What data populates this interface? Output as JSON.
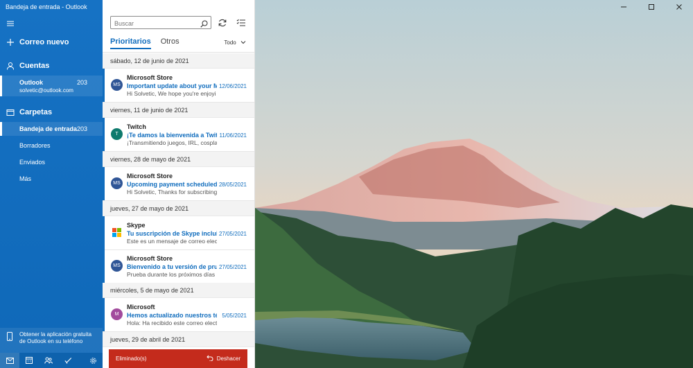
{
  "window": {
    "title": "Bandeja de entrada - Outlook"
  },
  "nav": {
    "new_mail": "Correo nuevo",
    "accounts_label": "Cuentas",
    "account": {
      "name": "Outlook",
      "email": "solvetic@outlook.com",
      "count": "203"
    },
    "folders_label": "Carpetas",
    "folders": [
      {
        "label": "Bandeja de entrada",
        "count": "203",
        "selected": true
      },
      {
        "label": "Borradores",
        "count": ""
      },
      {
        "label": "Enviados",
        "count": ""
      },
      {
        "label": "Más",
        "count": ""
      }
    ],
    "promo_line1": "Obtener la aplicación gratuita",
    "promo_line2": "de Outlook en su teléfono",
    "bottom_icons": [
      "mail-icon",
      "calendar-icon",
      "people-icon",
      "todo-icon",
      "settings-icon"
    ]
  },
  "list": {
    "search_placeholder": "Buscar",
    "tabs": [
      "Prioritarios",
      "Otros"
    ],
    "filter": "Todo",
    "groups": [
      {
        "date": "sábado, 12 de junio de 2021",
        "messages": [
          {
            "initials": "MS",
            "color": "#2f5596",
            "sender": "Microsoft Store",
            "subject": "Important update about your Micr",
            "preview": "Hi Solvetic, We hope you're enjoyi",
            "date": "12/06/2021"
          }
        ]
      },
      {
        "date": "viernes, 11 de junio de 2021",
        "messages": [
          {
            "initials": "T",
            "color": "#0e7a6d",
            "sender": "Twitch",
            "subject": "¡Te damos la bienvenida a Twitch!",
            "preview": "¡Transmitiendo juegos, IRL, cosplay",
            "date": "11/06/2021"
          }
        ]
      },
      {
        "date": "viernes, 28 de mayo de 2021",
        "messages": [
          {
            "initials": "MS",
            "color": "#2f5596",
            "sender": "Microsoft Store",
            "subject": "Upcoming payment scheduled for",
            "preview": "Hi Solvetic, Thanks for subscribing",
            "date": "28/05/2021"
          }
        ]
      },
      {
        "date": "jueves, 27 de mayo de 2021",
        "messages": [
          {
            "initials": "",
            "color": "",
            "logo": "windows-logo",
            "sender": "Skype",
            "subject": "Tu suscripción de Skype incluida c",
            "preview": "Este es un mensaje de correo electr",
            "date": "27/05/2021"
          },
          {
            "initials": "MS",
            "color": "#2f5596",
            "sender": "Microsoft Store",
            "subject": "Bienvenido a tu versión de prueba",
            "preview": "Prueba durante los próximos días",
            "date": "27/05/2021"
          }
        ]
      },
      {
        "date": "miércoles, 5 de mayo de 2021",
        "messages": [
          {
            "initials": "M",
            "color": "#a24b9d",
            "sender": "Microsoft",
            "subject": "Hemos actualizado nuestros términ",
            "preview": "Hola: Ha recibido este correo electr",
            "date": "5/05/2021"
          }
        ]
      },
      {
        "date": "jueves, 29 de abril de 2021",
        "messages": []
      }
    ],
    "toast": {
      "message": "Eliminado(s)",
      "undo": "Deshacer"
    }
  },
  "colors": {
    "accent": "#0f6cbd",
    "nav_bg": "#1672c4",
    "toast_bg": "#c42b1c"
  }
}
